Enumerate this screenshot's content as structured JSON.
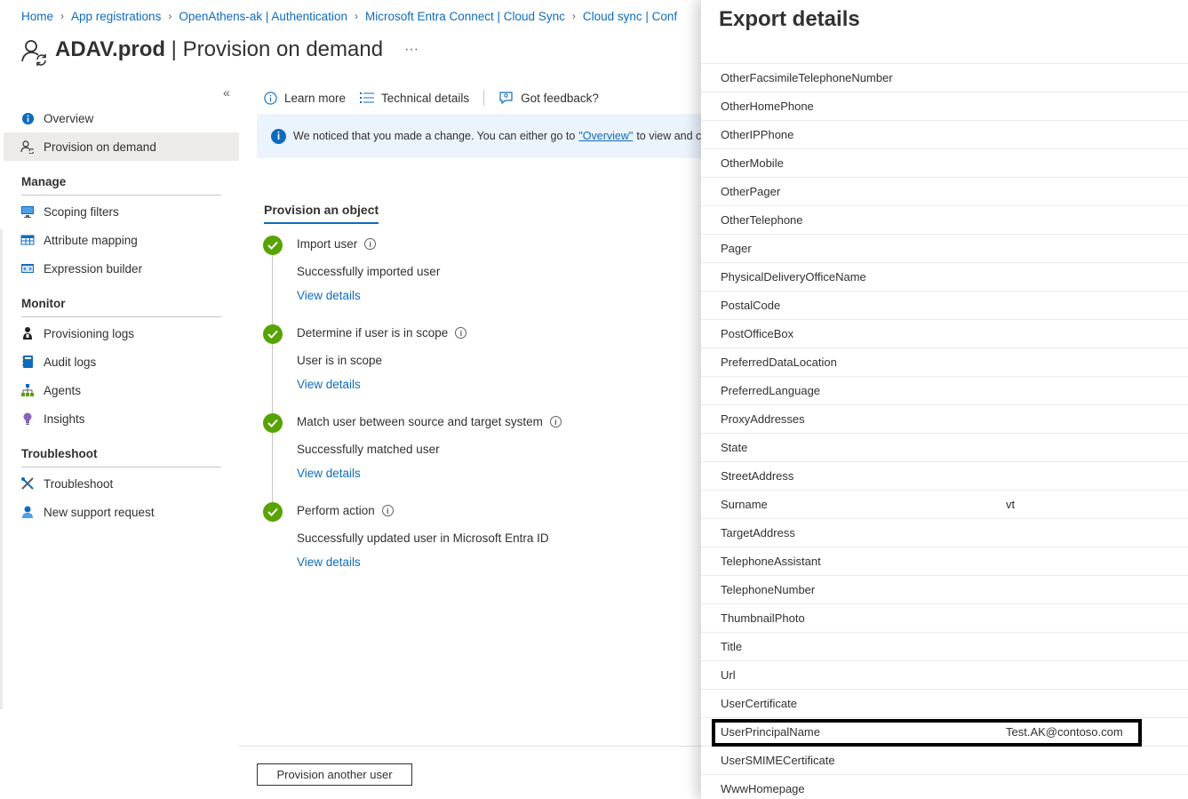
{
  "breadcrumb": [
    "Home",
    "App registrations",
    "OpenAthens-ak | Authentication",
    "Microsoft Entra Connect | Cloud Sync",
    "Cloud sync | Conf"
  ],
  "page": {
    "title_name": "ADAV.prod",
    "title_sep": " | ",
    "title_page": "Provision on demand",
    "more_label": "···"
  },
  "sidebar": {
    "collapse_label": "«",
    "top_items": [
      {
        "label": "Overview",
        "icon": "info-icon"
      },
      {
        "label": "Provision on demand",
        "icon": "provision-user-icon"
      }
    ],
    "sections": [
      {
        "heading": "Manage",
        "items": [
          {
            "label": "Scoping filters",
            "icon": "monitor-icon"
          },
          {
            "label": "Attribute mapping",
            "icon": "table-icon"
          },
          {
            "label": "Expression builder",
            "icon": "code-icon"
          }
        ]
      },
      {
        "heading": "Monitor",
        "items": [
          {
            "label": "Provisioning logs",
            "icon": "person-log-icon"
          },
          {
            "label": "Audit logs",
            "icon": "log-book-icon"
          },
          {
            "label": "Agents",
            "icon": "hierarchy-icon"
          },
          {
            "label": "Insights",
            "icon": "lightbulb-icon"
          }
        ]
      },
      {
        "heading": "Troubleshoot",
        "items": [
          {
            "label": "Troubleshoot",
            "icon": "wrench-icon"
          },
          {
            "label": "New support request",
            "icon": "support-person-icon"
          }
        ]
      }
    ]
  },
  "toolbar": {
    "learn_more": "Learn more",
    "technical_details": "Technical details",
    "feedback": "Got feedback?"
  },
  "banner": {
    "text_before": "We noticed that you made a change. You can either go to ",
    "link": "\"Overview\"",
    "text_after": " to view and confi"
  },
  "provision": {
    "tab_label": "Provision an object",
    "steps": [
      {
        "title": "Import user",
        "desc": "Successfully imported user",
        "link": "View details"
      },
      {
        "title": "Determine if user is in scope",
        "desc": "User is in scope",
        "link": "View details"
      },
      {
        "title": "Match user between source and target system",
        "desc": "Successfully matched user",
        "link": "View details"
      },
      {
        "title": "Perform action",
        "desc": "Successfully updated user in Microsoft Entra ID",
        "link": "View details"
      }
    ],
    "another_button": "Provision another user"
  },
  "export_panel": {
    "title": "Export details",
    "rows": [
      {
        "key": "OtherFacsimileTelephoneNumber",
        "value": ""
      },
      {
        "key": "OtherHomePhone",
        "value": ""
      },
      {
        "key": "OtherIPPhone",
        "value": ""
      },
      {
        "key": "OtherMobile",
        "value": ""
      },
      {
        "key": "OtherPager",
        "value": ""
      },
      {
        "key": "OtherTelephone",
        "value": ""
      },
      {
        "key": "Pager",
        "value": ""
      },
      {
        "key": "PhysicalDeliveryOfficeName",
        "value": ""
      },
      {
        "key": "PostalCode",
        "value": ""
      },
      {
        "key": "PostOfficeBox",
        "value": ""
      },
      {
        "key": "PreferredDataLocation",
        "value": ""
      },
      {
        "key": "PreferredLanguage",
        "value": ""
      },
      {
        "key": "ProxyAddresses",
        "value": ""
      },
      {
        "key": "State",
        "value": ""
      },
      {
        "key": "StreetAddress",
        "value": ""
      },
      {
        "key": "Surname",
        "value": "vt"
      },
      {
        "key": "TargetAddress",
        "value": ""
      },
      {
        "key": "TelephoneAssistant",
        "value": ""
      },
      {
        "key": "TelephoneNumber",
        "value": ""
      },
      {
        "key": "ThumbnailPhoto",
        "value": ""
      },
      {
        "key": "Title",
        "value": ""
      },
      {
        "key": "Url",
        "value": ""
      },
      {
        "key": "UserCertificate",
        "value": ""
      },
      {
        "key": "UserPrincipalName",
        "value": "Test.AK@contoso.com",
        "highlighted": true
      },
      {
        "key": "UserSMIMECertificate",
        "value": ""
      },
      {
        "key": "WwwHomepage",
        "value": ""
      }
    ]
  },
  "colors": {
    "accent": "#0f6cbd",
    "success": "#57a300",
    "banner_bg": "#ebf3fc",
    "nav_active_bg": "#edebe9"
  }
}
